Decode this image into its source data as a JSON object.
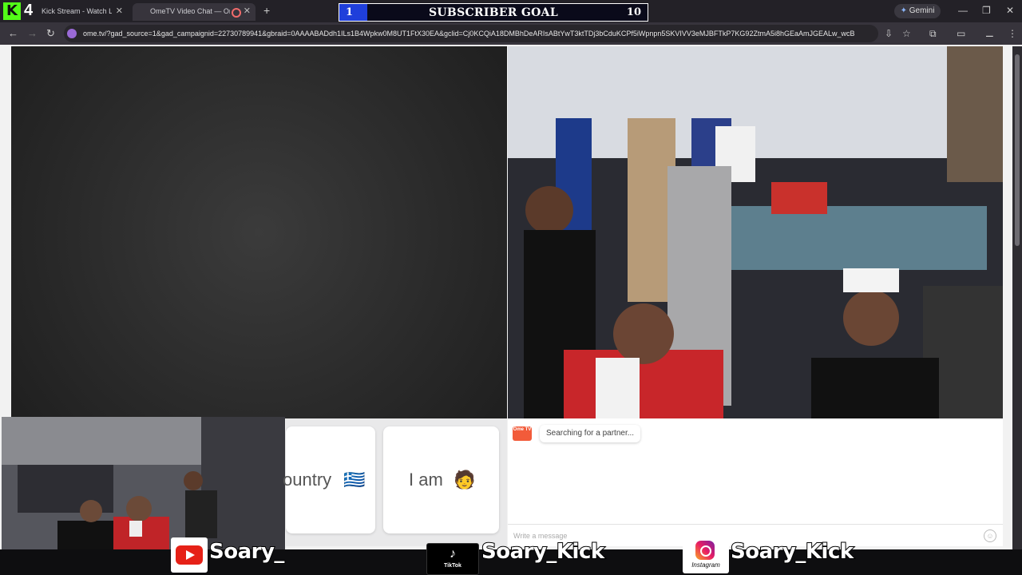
{
  "stream_overlay": {
    "kick_logo": "K",
    "viewer_count": "4",
    "subscriber_goal": {
      "title": "SUBSCRIBER GOAL",
      "start": "1",
      "end": "10",
      "progress_fraction": 0.09
    },
    "socials": [
      {
        "platform": "YouTube",
        "icon": "youtube-icon",
        "handle": "Soary_"
      },
      {
        "platform": "TikTok",
        "icon": "tiktok-icon",
        "icon_label": "TikTok",
        "handle": "Soary_Kick"
      },
      {
        "platform": "Instagram",
        "icon": "instagram-icon",
        "icon_label": "Instagram",
        "handle": "Soary_Kick"
      }
    ]
  },
  "browser": {
    "tabs": [
      {
        "title": "Kick Stream - Watch Live",
        "active": false
      },
      {
        "title": "OmeTV Video Chat — Ome",
        "active": true
      }
    ],
    "new_tab": "+",
    "gemini_label": "Gemini",
    "url": "ome.tv/?gad_source=1&gad_campaignid=22730789941&gbraid=0AAAABADdh1ILs1B4Wpkw0M8UT1FtX30EA&gclid=Cj0KCQiA18DMBhDeARIsABtYwT3ktTDj3bCduKCPf5iWpnpn5SKVIVV3eMJBFTkP7KG92ZtmA5i8hGEaAmJGEALw_wcB",
    "accent": "#53fc18"
  },
  "omegle": {
    "filters": {
      "country_label": "ountry",
      "country_flag": "🇬🇷",
      "gender_label": "I am",
      "gender_emoji": "🧑"
    },
    "chat": {
      "logo_text": "Ome TV",
      "status": "Searching for a partner...",
      "placeholder": "Write a message"
    }
  }
}
